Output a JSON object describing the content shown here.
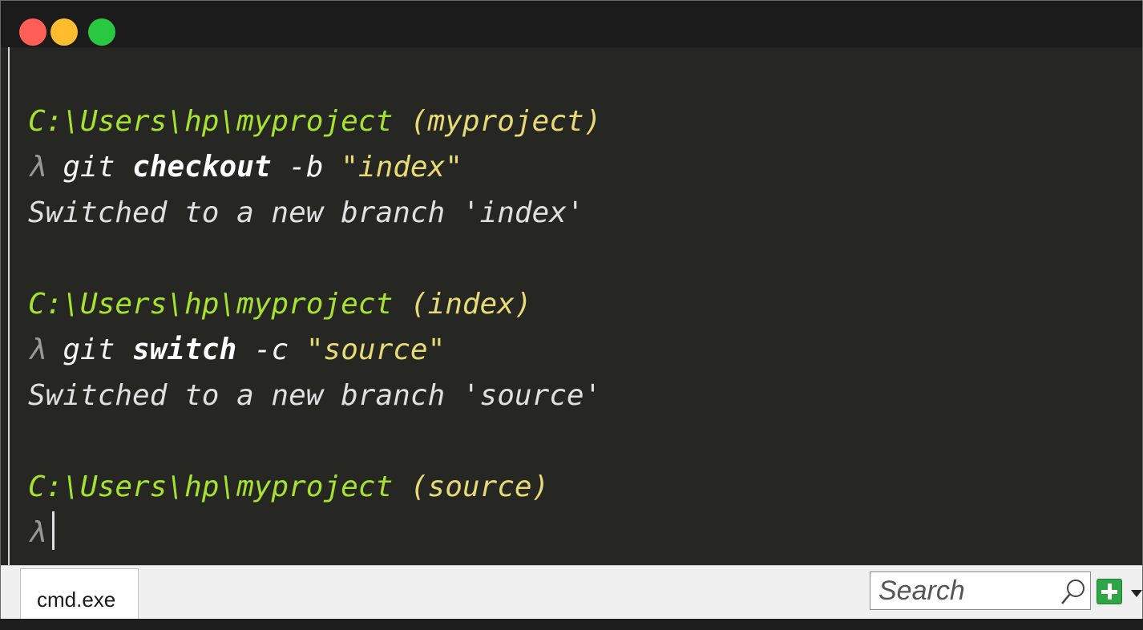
{
  "terminal": {
    "blocks": [
      {
        "path": "C:\\Users\\hp\\myproject",
        "branch": "(myproject)",
        "prompt": "λ",
        "cmd": {
          "git": "git",
          "verb": "checkout",
          "flag": "-b",
          "arg": "\"index\""
        },
        "output": "Switched to a new branch 'index'"
      },
      {
        "path": "C:\\Users\\hp\\myproject",
        "branch": "(index)",
        "prompt": "λ",
        "cmd": {
          "git": "git",
          "verb": "switch",
          "flag": "-c",
          "arg": "\"source\""
        },
        "output": "Switched to a new branch 'source'"
      },
      {
        "path": "C:\\Users\\hp\\myproject",
        "branch": "(source)",
        "prompt": "λ"
      }
    ]
  },
  "statusbar": {
    "tab_label": "cmd.exe",
    "search_placeholder": "Search"
  },
  "icons": {
    "search": "search-icon",
    "add": "plus-icon",
    "dropdown": "chevron-down-icon"
  },
  "colors": {
    "background": "#262723",
    "path": "#a6e22e",
    "branch": "#e6db74",
    "add_button": "#2ea646"
  }
}
